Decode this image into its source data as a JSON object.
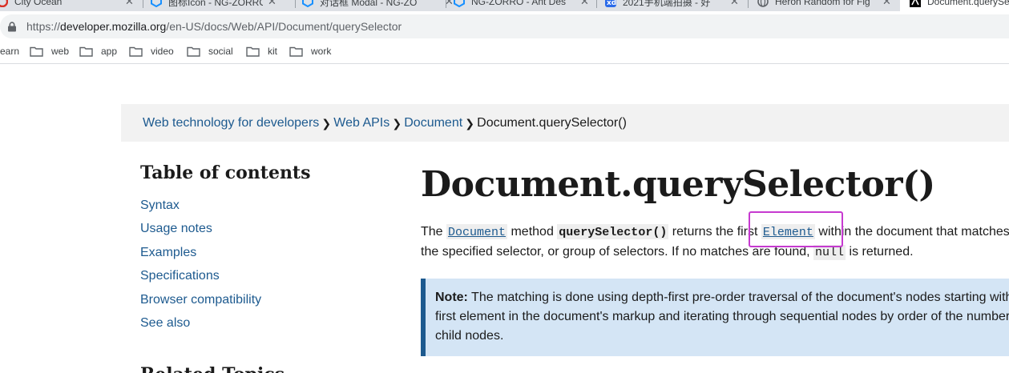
{
  "browser": {
    "tabs": [
      {
        "title": "City Ocean",
        "icon": "red-c-logo-icon",
        "color": "#d93025"
      },
      {
        "title": "图标Icon - NG-ZORRO",
        "icon": "ng-zorro-logo-icon",
        "color": "#1890ff"
      },
      {
        "title": "对话框 Modal - NG-ZO",
        "icon": "ng-zorro-logo-icon",
        "color": "#1890ff"
      },
      {
        "title": "NG-ZORRO - Ant Des",
        "icon": "ng-zorro-logo-icon",
        "color": "#1890ff"
      },
      {
        "title": "2021手机端拍摄 - 好",
        "icon": "xd-logo-icon",
        "color": "#2a6ae9"
      },
      {
        "title": "Heron Random for Fig",
        "icon": "globe-icon",
        "color": "#5f6368"
      },
      {
        "title": "Document.querySe",
        "icon": "mdn-logo-icon",
        "color": "#000000"
      }
    ],
    "close_glyph": "✕",
    "url_prefix": "https://",
    "url_host": "developer.mozilla.org",
    "url_path": "/en-US/docs/Web/API/Document/querySelector",
    "bookmarks": [
      "earn",
      "web",
      "app",
      "video",
      "social",
      "kit",
      "work"
    ]
  },
  "breadcrumbs": {
    "items": [
      "Web technology for developers",
      "Web APIs",
      "Document"
    ],
    "current": "Document.querySelector()",
    "separator": "❯"
  },
  "toc": {
    "title": "Table of contents",
    "items": [
      "Syntax",
      "Usage notes",
      "Examples",
      "Specifications",
      "Browser compatibility",
      "See also"
    ]
  },
  "related_title": "Related Topics",
  "article": {
    "title": "Document.querySelector()",
    "p1": {
      "t1": "The ",
      "code_document": "Document",
      "t2": " method ",
      "code_method": "querySelector()",
      "t3": " returns the first ",
      "code_element": "Element",
      "t4": " within the document that matches",
      "line2_a": "the specified selector, or group of selectors. If no matches are found, ",
      "code_null": "null",
      "line2_b": " is returned."
    },
    "note": {
      "label": "Note:",
      "line1": " The matching is done using depth-first pre-order traversal of the document's nodes starting with the",
      "line2": "first element in the document's markup and iterating through sequential nodes by order of the number of",
      "line3": "child nodes."
    }
  },
  "colors": {
    "link": "#1d5a8f",
    "note_bg": "#d4e5f5",
    "highlight_box": "#c63ad0",
    "crumb_bg": "#f2f2f2"
  }
}
